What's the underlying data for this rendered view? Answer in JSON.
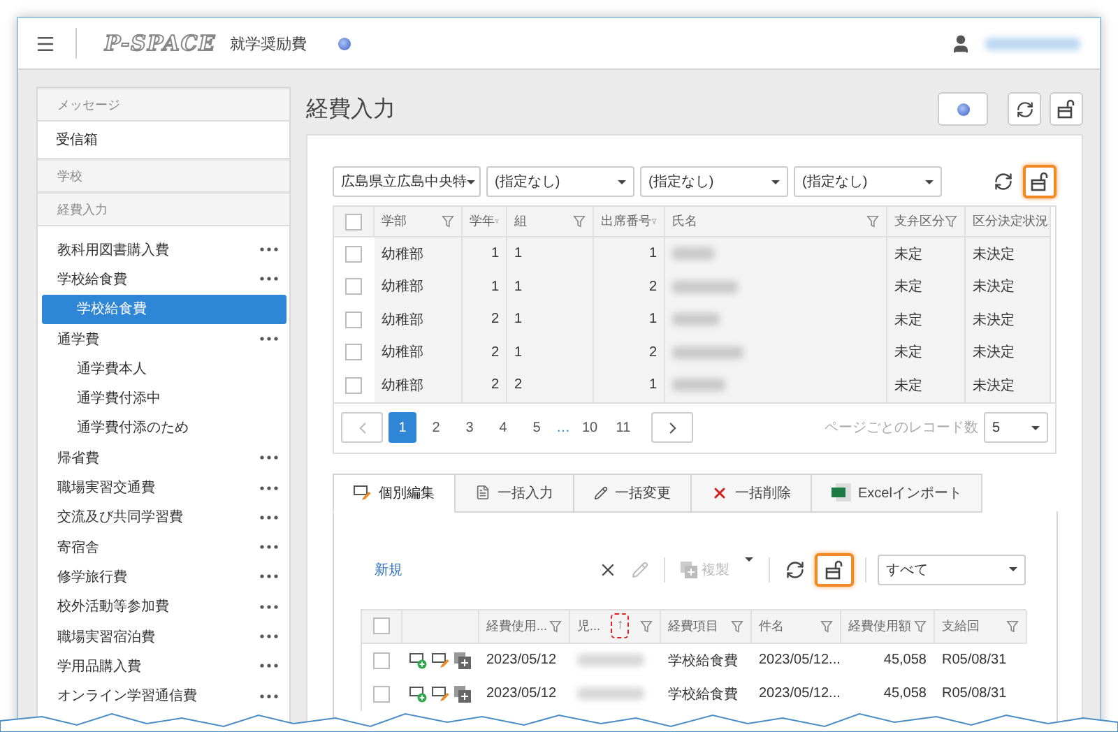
{
  "header": {
    "logo": "P-SPACE",
    "app_name": "就学奨励費"
  },
  "sidebar": [
    {
      "kind": "header",
      "label": "メッセージ"
    },
    {
      "kind": "link",
      "label": "受信箱",
      "selected": false
    },
    {
      "kind": "header",
      "label": "学校"
    },
    {
      "kind": "header",
      "label": "経費入力"
    },
    {
      "kind": "group",
      "label": "教科用図書購入費",
      "more": true,
      "selected": false
    },
    {
      "kind": "group",
      "label": "学校給食費",
      "more": true,
      "selected": false,
      "children": [
        {
          "label": "学校給食費",
          "selected": true
        }
      ]
    },
    {
      "kind": "group",
      "label": "通学費",
      "more": true,
      "selected": false,
      "children": [
        {
          "label": "通学費本人",
          "selected": false
        },
        {
          "label": "通学費付添中",
          "selected": false
        },
        {
          "label": "通学費付添のため",
          "selected": false
        }
      ]
    },
    {
      "kind": "group",
      "label": "帰省費",
      "more": true,
      "selected": false
    },
    {
      "kind": "group",
      "label": "職場実習交通費",
      "more": true,
      "selected": false
    },
    {
      "kind": "group",
      "label": "交流及び共同学習費",
      "more": true,
      "selected": false
    },
    {
      "kind": "group",
      "label": "寄宿舎",
      "more": true,
      "selected": false
    },
    {
      "kind": "group",
      "label": "修学旅行費",
      "more": true,
      "selected": false
    },
    {
      "kind": "group",
      "label": "校外活動等参加費",
      "more": true,
      "selected": false
    },
    {
      "kind": "group",
      "label": "職場実習宿泊費",
      "more": true,
      "selected": false
    },
    {
      "kind": "group",
      "label": "学用品購入費",
      "more": true,
      "selected": false
    },
    {
      "kind": "group",
      "label": "オンライン学習通信費",
      "more": true,
      "selected": false
    }
  ],
  "page": {
    "title": "経費入力",
    "lock_highlighted": false
  },
  "filters": [
    {
      "value": "広島県立広島中央特"
    },
    {
      "value": "(指定なし)"
    },
    {
      "value": "(指定なし)"
    },
    {
      "value": "(指定なし)"
    }
  ],
  "student_grid": {
    "lock_highlighted": true,
    "all_checked": false,
    "columns": [
      {
        "label": "学部",
        "kind": "text"
      },
      {
        "label": "学年",
        "kind": "number"
      },
      {
        "label": "組",
        "kind": "text"
      },
      {
        "label": "出席番号",
        "kind": "number"
      },
      {
        "label": "氏名",
        "kind": "blurred"
      },
      {
        "label": "支弁区分",
        "kind": "text"
      },
      {
        "label": "区分決定状況",
        "kind": "text"
      }
    ],
    "rows": [
      {
        "checked": false,
        "cells": [
          "幼稚部",
          "1",
          "1",
          "1",
          "",
          "未定",
          "未決定"
        ]
      },
      {
        "checked": false,
        "cells": [
          "幼稚部",
          "1",
          "1",
          "2",
          "",
          "未定",
          "未決定"
        ]
      },
      {
        "checked": false,
        "cells": [
          "幼稚部",
          "2",
          "1",
          "1",
          "",
          "未定",
          "未決定"
        ]
      },
      {
        "checked": false,
        "cells": [
          "幼稚部",
          "2",
          "1",
          "2",
          "",
          "未定",
          "未決定"
        ]
      },
      {
        "checked": false,
        "cells": [
          "幼稚部",
          "2",
          "2",
          "1",
          "",
          "未定",
          "未決定"
        ]
      }
    ]
  },
  "pager": {
    "prev_disabled": true,
    "next_disabled": false,
    "pages": [
      {
        "label": "1",
        "kind": "page",
        "selected": true
      },
      {
        "label": "2",
        "kind": "page",
        "selected": false
      },
      {
        "label": "3",
        "kind": "page",
        "selected": false
      },
      {
        "label": "4",
        "kind": "page",
        "selected": false
      },
      {
        "label": "5",
        "kind": "page",
        "selected": false
      },
      {
        "label": "…",
        "kind": "ellipsis"
      },
      {
        "label": "10",
        "kind": "page",
        "selected": false
      },
      {
        "label": "11",
        "kind": "page",
        "selected": false
      }
    ],
    "records_label": "ページごとのレコード数",
    "per_page": "5"
  },
  "tabs": [
    {
      "label": "個別編集",
      "kind": "edit",
      "selected": true
    },
    {
      "label": "一括入力",
      "kind": "document",
      "selected": false
    },
    {
      "label": "一括変更",
      "kind": "pencil",
      "selected": false
    },
    {
      "label": "一括削除",
      "kind": "delete",
      "selected": false
    },
    {
      "label": "Excelインポート",
      "kind": "excel",
      "selected": false
    }
  ],
  "toolbar": {
    "new_link": "新規",
    "edit_disabled": true,
    "copy": {
      "label": "複製",
      "disabled": true
    },
    "lock_highlighted": true,
    "view": "すべて"
  },
  "expense_grid": {
    "all_checked": false,
    "columns": [
      {
        "label": "経費使用...",
        "kind": "text"
      },
      {
        "label": "児...",
        "kind": "blurred",
        "sort_icon": "↑",
        "highlighted": true
      },
      {
        "label": "経費項目",
        "kind": "text"
      },
      {
        "label": "件名",
        "kind": "text"
      },
      {
        "label": "経費使用額",
        "kind": "number"
      },
      {
        "label": "支給回",
        "kind": "text"
      }
    ],
    "rows": [
      {
        "checked": false,
        "cells": [
          "2023/05/12",
          "",
          "学校給食費",
          "2023/05/12...",
          "45,058",
          "R05/08/31"
        ]
      },
      {
        "checked": false,
        "cells": [
          "2023/05/12",
          "",
          "学校給食費",
          "2023/05/12...",
          "45,058",
          "R05/08/31"
        ]
      }
    ]
  }
}
